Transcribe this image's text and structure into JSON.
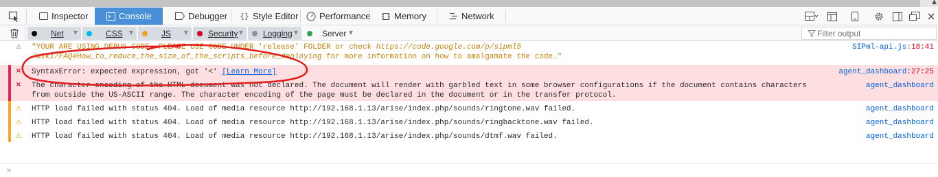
{
  "toolbox": {
    "tabs": [
      {
        "label": "Inspector",
        "icon": "inspector-icon"
      },
      {
        "label": "Console",
        "icon": "console-icon",
        "selected": true
      },
      {
        "label": "Debugger",
        "icon": "debugger-icon"
      },
      {
        "label": "Style Editor",
        "icon": "style-editor-icon"
      },
      {
        "label": "Performance",
        "icon": "performance-icon"
      },
      {
        "label": "Memory",
        "icon": "memory-icon"
      },
      {
        "label": "Network",
        "icon": "network-icon"
      }
    ],
    "style_editor_glyph": "{}"
  },
  "filters": {
    "buttons": [
      {
        "label": "Net",
        "color": "#0c0c0d",
        "on": true
      },
      {
        "label": "CSS",
        "color": "#00b6f0",
        "on": true
      },
      {
        "label": "JS",
        "color": "#f0a020",
        "on": true
      },
      {
        "label": "Security",
        "color": "#d70022",
        "on": true
      },
      {
        "label": "Logging",
        "color": "#8f8f9d",
        "on": true
      },
      {
        "label": "Server",
        "color": "#30a050",
        "on": false
      }
    ],
    "filter_placeholder": "Filter output"
  },
  "messages": [
    {
      "type": "log",
      "text_line1": "\"YOUR ARE USING DEBUG CODE. PLEASE USE CODE UNDER 'release' FOLDER or check ",
      "link_line1": "https://code.google.com/p/sipml5",
      "link_line2": "/wiki/FAQ#How_to_reduce_the_size_of_the_scripts_before_deploying",
      "text_line2": " for more information on how to amalgamate the code.\"",
      "source": "SIPml-api.js",
      "line": ":18:41"
    },
    {
      "type": "error",
      "text": "SyntaxError: expected expression, got '<' ",
      "learn_more": "[Learn More]",
      "source": "agent_dashboard",
      "line": ":27:25"
    },
    {
      "type": "error",
      "text_line1": "The character encoding of the HTML document was not declared. The document will render with garbled text in some browser configurations if the document contains characters",
      "text_line2": "from outside the US-ASCII range. The character encoding of the page must be declared in the document or in the transfer protocol.",
      "source": "agent_dashboard"
    },
    {
      "type": "warning",
      "text": "HTTP load failed with status 404. Load of media resource http://192.168.1.13/arise/index.php/sounds/ringtone.wav failed.",
      "source": "agent_dashboard"
    },
    {
      "type": "warning",
      "text": "HTTP load failed with status 404. Load of media resource http://192.168.1.13/arise/index.php/sounds/ringbacktone.wav failed.",
      "source": "agent_dashboard"
    },
    {
      "type": "warning",
      "text": "HTTP load failed with status 404. Load of media resource http://192.168.1.13/arise/index.php/sounds/dtmf.wav failed.",
      "source": "agent_dashboard"
    }
  ],
  "input": {
    "prompt": "»"
  },
  "colors": {
    "accent": "#4a90d9",
    "error_bg": "#fddee1",
    "error_bar": "#e22850",
    "warning_bar": "#f5a623",
    "annotation": "#e0201c"
  }
}
